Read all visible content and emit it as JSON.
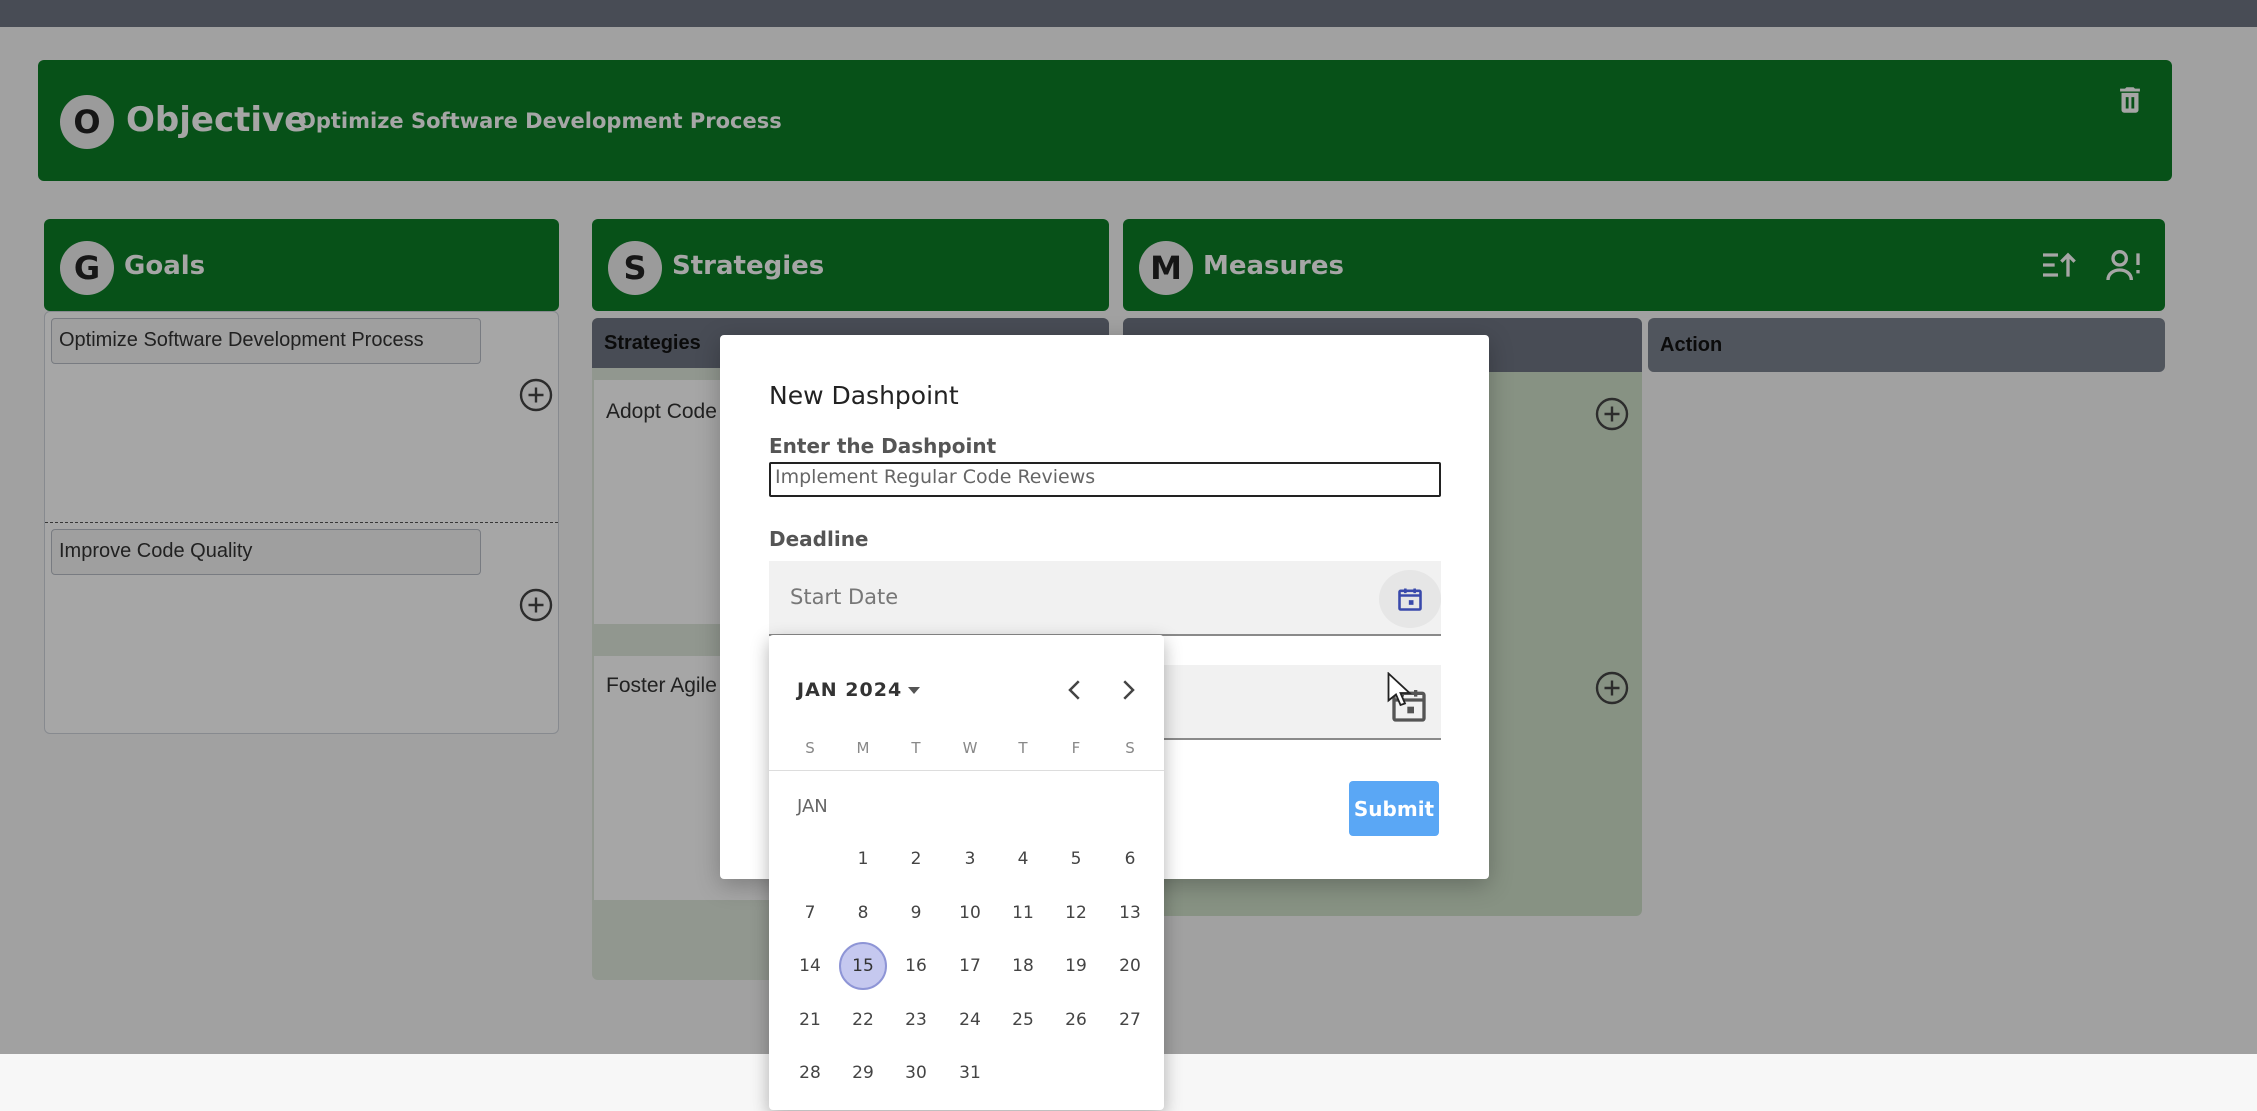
{
  "objective": {
    "badge": "O",
    "title": "Objective",
    "subtitle": "Optimize Software Development Process"
  },
  "columns": {
    "goals": {
      "badge": "G",
      "title": "Goals"
    },
    "strategies": {
      "badge": "S",
      "title": "Strategies"
    },
    "measures": {
      "badge": "M",
      "title": "Measures"
    }
  },
  "goals": [
    {
      "label": "Optimize Software Development Process"
    },
    {
      "label": "Improve Code Quality"
    }
  ],
  "strategies": {
    "header": "Strategies",
    "items": [
      {
        "label": "Adopt Code"
      },
      {
        "label": "Foster Agile"
      }
    ]
  },
  "action": {
    "header": "Action"
  },
  "modal": {
    "title": "New Dashpoint",
    "dashpoint_label": "Enter the Dashpoint",
    "dashpoint_value": "Implement Regular Code Reviews",
    "deadline_label": "Deadline",
    "start_placeholder": "Start Date",
    "submit_label": "Submit"
  },
  "datepicker": {
    "month_year": "JAN 2024",
    "month_label": "JAN",
    "weekdays": [
      "S",
      "M",
      "T",
      "W",
      "T",
      "F",
      "S"
    ],
    "selected_day": 15,
    "first_weekday_index": 1,
    "days_in_month": 31
  },
  "colors": {
    "header_green": "#0b7d26",
    "gray_header": "#6f7683",
    "submit_blue": "#5aa7f5",
    "selected_day": "#c5c8ef"
  },
  "icons": [
    "trash-icon",
    "add-circle-icon",
    "sort-icon",
    "person-alert-icon",
    "calendar-icon",
    "chevron-left-icon",
    "chevron-right-icon",
    "caret-down-icon",
    "mouse-cursor-icon"
  ]
}
